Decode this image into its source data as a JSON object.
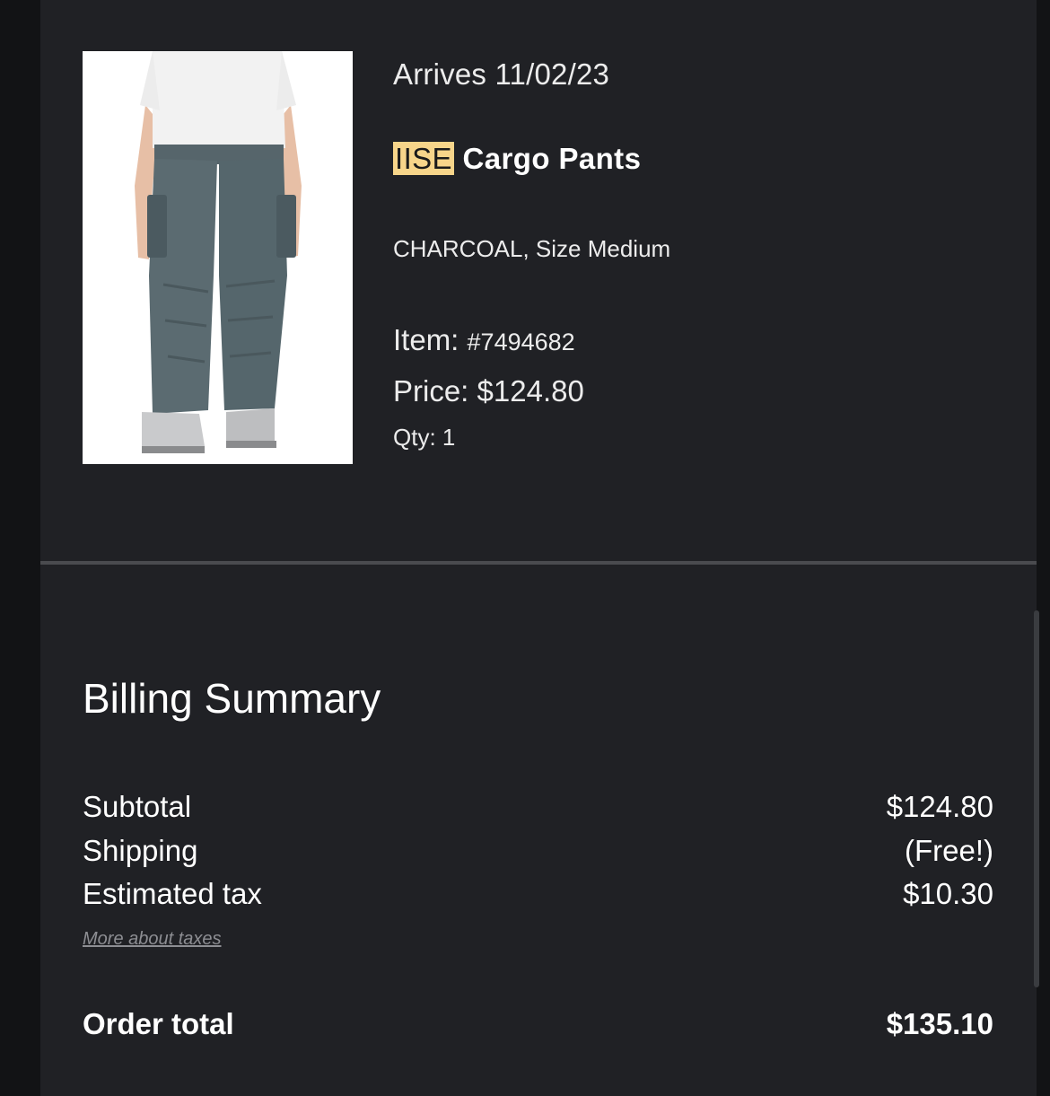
{
  "order_item": {
    "arrives": "Arrives 11/02/23",
    "brand": "IISE",
    "name": "Cargo Pants",
    "variant": "CHARCOAL, Size Medium",
    "item_label": "Item:",
    "item_number": "#7494682",
    "price_label": "Price:",
    "price": "$124.80",
    "qty": "Qty: 1",
    "image_icon": "product-photo-cargo-pants"
  },
  "billing": {
    "title": "Billing Summary",
    "rows": [
      {
        "label": "Subtotal",
        "value": "$124.80"
      },
      {
        "label": "Shipping",
        "value": "(Free!)"
      },
      {
        "label": "Estimated tax",
        "value": "$10.30"
      }
    ],
    "taxes_link": "More about taxes",
    "total_label": "Order total",
    "total_value": "$135.10"
  },
  "colors": {
    "background": "#202125",
    "brand_highlight": "#f7d58a",
    "text": "#ffffff",
    "muted_link": "#8d8e93"
  }
}
